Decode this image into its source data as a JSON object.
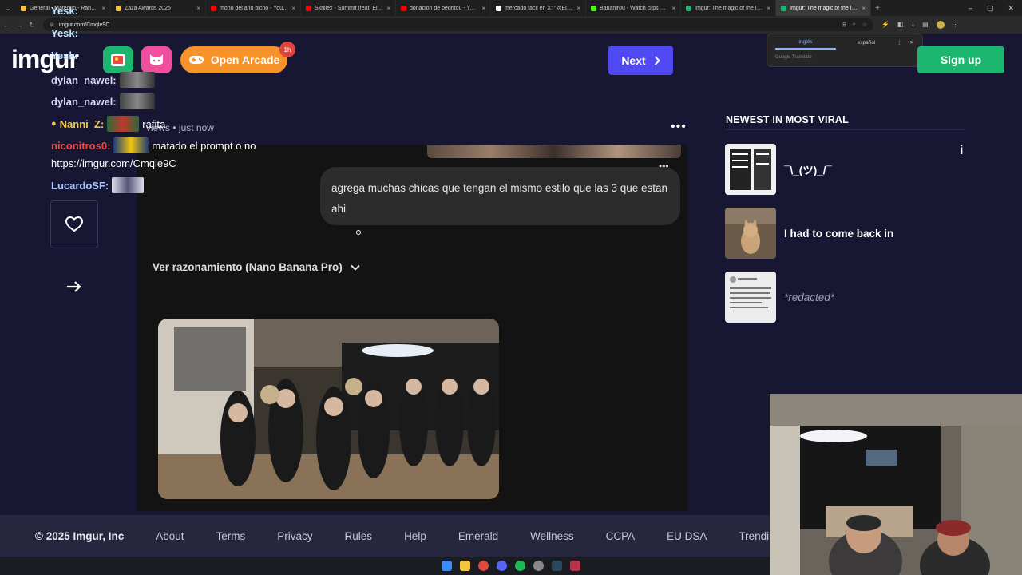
{
  "browser": {
    "tabs": [
      {
        "title": "General - Matecun - Ranking",
        "favicon_color": "#f5c542"
      },
      {
        "title": "Zaza Awards 2025",
        "favicon_color": "#f5c542"
      },
      {
        "title": "moño del año bicho - YouTube",
        "favicon_color": "#ff0000"
      },
      {
        "title": "Skrillex - Summit (feat. Ellie Go",
        "favicon_color": "#ff0000"
      },
      {
        "title": "donación de pedritou - YouTub",
        "favicon_color": "#ff0000"
      },
      {
        "title": "mercado facil en X: \"@ElGordo",
        "favicon_color": "#ffffff"
      },
      {
        "title": "Bananirou - Watch clips on Kick",
        "favicon_color": "#53fc18"
      },
      {
        "title": "Imgur: The magic of the Intern",
        "favicon_color": "#1bb76e"
      },
      {
        "title": "Imgur: The magic of the Intern",
        "favicon_color": "#1bb76e"
      }
    ],
    "active_tab_index": 8,
    "url": "imgur.com/Cmqle9C"
  },
  "translate_popup": {
    "lang_from": "inglés",
    "lang_to": "español",
    "footer": "Google Translate"
  },
  "header": {
    "logo": "imgur",
    "arcade_label": "Open Arcade",
    "arcade_badge": "1h",
    "next_label": "Next",
    "signup_label": "Sign up"
  },
  "chat": {
    "messages": [
      {
        "user": "Yesk:",
        "text": "",
        "color": "#bfe3ff"
      },
      {
        "user": "Yesk:",
        "text": "",
        "color": "#bfe3ff"
      },
      {
        "user": "Yesk:",
        "text": "",
        "color": "#bfe3ff"
      },
      {
        "user": "dylan_nawel:",
        "text": "",
        "color": "#dcd6f7"
      },
      {
        "user": "dylan_nawel:",
        "text": "",
        "color": "#dcd6f7"
      },
      {
        "user": "Nanni_Z:",
        "text": "rafita",
        "color": "#f2c94c"
      },
      {
        "user": "niconitros0:",
        "text": "matado el prompt o no",
        "color": "#e84a4a"
      },
      {
        "user": "",
        "text": "https://imgur.com/Cmqle9C",
        "color": "#ffffff"
      },
      {
        "user": "LucardoSF:",
        "text": "",
        "color": "#a9c7ff"
      }
    ]
  },
  "post": {
    "meta_views": "views",
    "meta_time": "just now",
    "bubble_text": "agrega muchas chicas que tengan el mismo estilo que las 3 que estan ahi",
    "reasoning_label": "Ver razonamiento (Nano Banana Pro)"
  },
  "sidebar": {
    "title": "NEWEST IN MOST VIRAL",
    "items": [
      {
        "caption": "¯\\_(ツ)_/¯"
      },
      {
        "caption": "I had to come back in"
      },
      {
        "caption": "*redacted*"
      }
    ]
  },
  "footer": {
    "copyright": "© 2025 Imgur, Inc",
    "links": [
      "About",
      "Terms",
      "Privacy",
      "Rules",
      "Help",
      "Emerald",
      "Wellness",
      "CCPA",
      "EU DSA",
      "Trending"
    ]
  },
  "icons": {
    "like": "heart-icon",
    "share": "share-arrow-icon",
    "next": "chevron-right-icon",
    "reason_toggle": "chevron-down-icon",
    "more": "more-dots-icon",
    "arcade": "gamepad-icon"
  },
  "colors": {
    "page_bg": "#171734",
    "next_button": "#5048f3",
    "signup_button": "#1bb76e",
    "arcade_button": "#f7932a"
  }
}
